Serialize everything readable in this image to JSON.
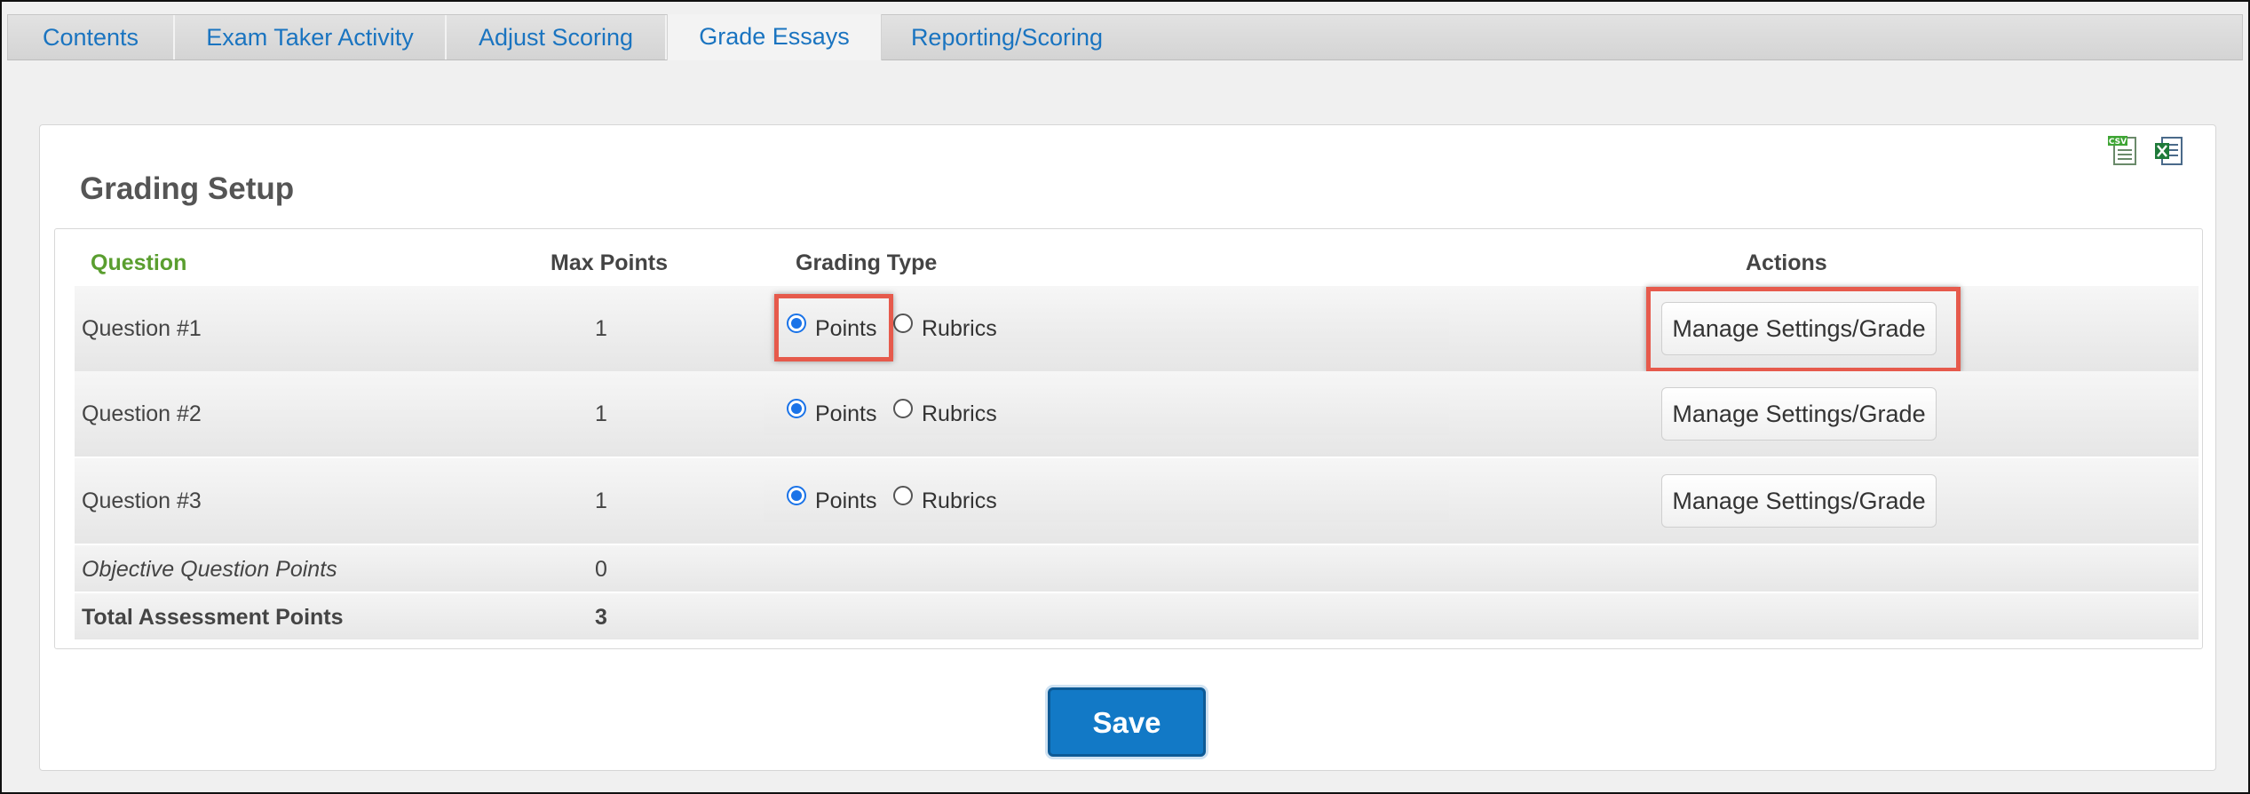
{
  "tabs": [
    {
      "label": "Contents"
    },
    {
      "label": "Exam Taker Activity"
    },
    {
      "label": "Adjust Scoring"
    },
    {
      "label": "Grade Essays"
    },
    {
      "label": "Reporting/Scoring"
    }
  ],
  "active_tab": "Grade Essays",
  "panel": {
    "title": "Grading Setup",
    "icons": [
      "csv-export-icon",
      "excel-export-icon"
    ]
  },
  "table": {
    "headers": {
      "question": "Question",
      "max_points": "Max Points",
      "grading_type": "Grading Type",
      "actions": "Actions"
    },
    "rows": [
      {
        "question": "Question #1",
        "max_points": "1",
        "grading_type": "Points",
        "option_points": "Points",
        "option_rubrics": "Rubrics",
        "action": "Manage Settings/Grade"
      },
      {
        "question": "Question #2",
        "max_points": "1",
        "grading_type": "Points",
        "option_points": "Points",
        "option_rubrics": "Rubrics",
        "action": "Manage Settings/Grade"
      },
      {
        "question": "Question #3",
        "max_points": "1",
        "grading_type": "Points",
        "option_points": "Points",
        "option_rubrics": "Rubrics",
        "action": "Manage Settings/Grade"
      }
    ],
    "summary": [
      {
        "label": "Objective Question Points",
        "value": "0"
      },
      {
        "label": "Total Assessment Points",
        "value": "3"
      }
    ]
  },
  "save_label": "Save",
  "colors": {
    "tab_text": "#1a74c0",
    "question_header": "#5a9e2f",
    "highlight": "#e65a4c",
    "save_button": "#1279c6",
    "radio_selected": "#1a73e8"
  }
}
